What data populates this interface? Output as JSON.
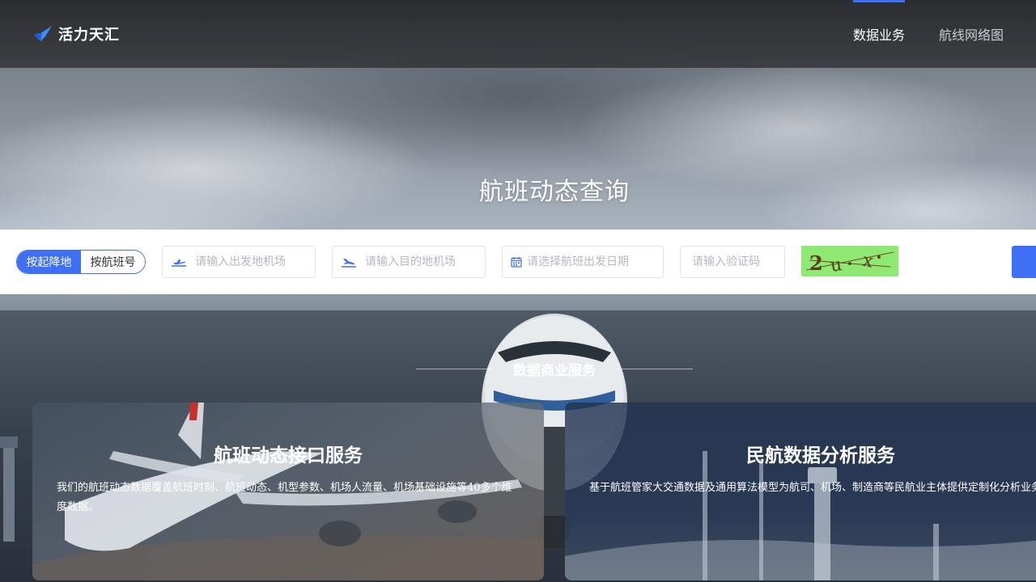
{
  "header": {
    "logo_text": "活力天汇",
    "nav": [
      {
        "label": "数据业务",
        "active": true
      },
      {
        "label": "航线网络图",
        "active": false
      }
    ]
  },
  "hero": {
    "title": "航班动态查询"
  },
  "search": {
    "mode_options": [
      {
        "label": "按起降地",
        "active": true
      },
      {
        "label": "按航班号",
        "active": false
      }
    ],
    "departure_placeholder": "请输入出发地机场",
    "arrival_placeholder": "请输入目的地机场",
    "date_placeholder": "请选择航班出发日期",
    "captcha_placeholder": "请输入验证码",
    "captcha_image_text": "2ux"
  },
  "services": {
    "section_title": "数据商业服务",
    "cards": [
      {
        "title": "航班动态接口服务",
        "description": "我们的航班动态数据覆盖航班时刻、航班动态、机型参数、机场人流量、机场基础设施等40多个维度数据。"
      },
      {
        "title": "民航数据分析服务",
        "description": "基于航班管家大交通数据及通用算法模型为航司、机场、制造商等民航业主体提供定制化分析业务。"
      }
    ]
  },
  "colors": {
    "accent": "#3e6ff5",
    "captcha_bg": "#8ee872",
    "header_bg": "#2f3135"
  },
  "icons": [
    "logo-mark-icon",
    "takeoff-icon",
    "landing-icon",
    "calendar-icon"
  ]
}
